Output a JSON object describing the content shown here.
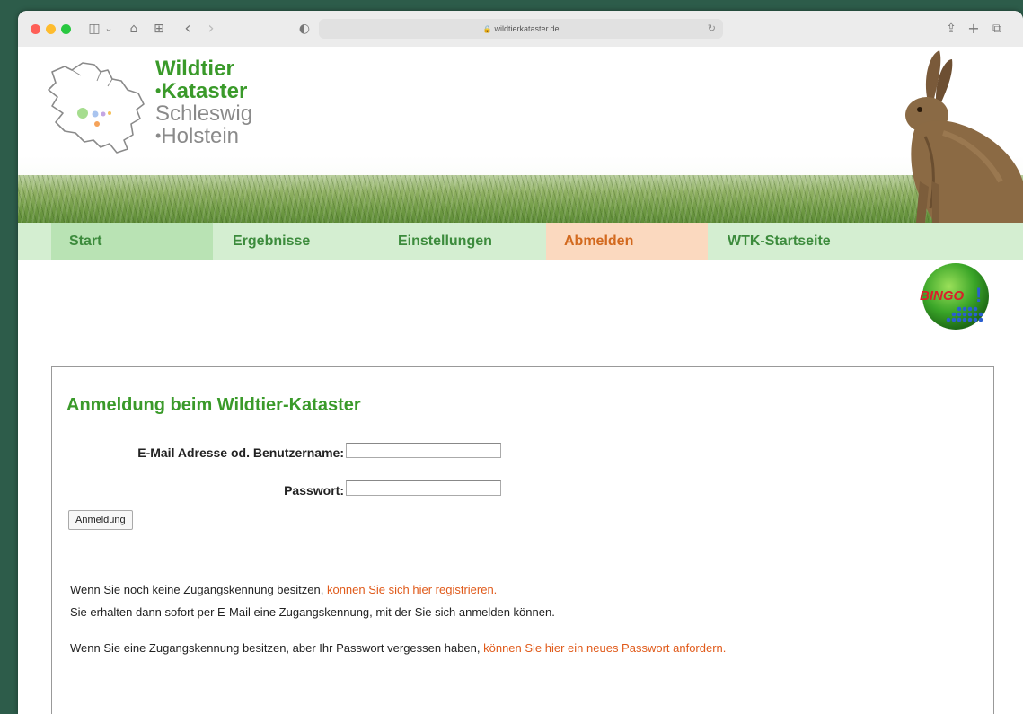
{
  "browser": {
    "url": "wildtierkataster.de",
    "lock_glyph": "🔒",
    "reload_glyph": "↻",
    "icons": [
      "sidebar-icon",
      "home-icon",
      "tab-overview-icon",
      "back-icon",
      "forward-icon",
      "privacy-icon",
      "share-icon",
      "new-tab-icon",
      "tabs-icon"
    ],
    "icon_glyphs": {
      "sidebar": "◫",
      "chevron": "⌄",
      "home": "⌂",
      "overview": "⊞",
      "back": "‹",
      "forward": "›",
      "privacy": "◐",
      "share": "⇪",
      "new_tab": "+",
      "tabs": "⧉"
    }
  },
  "logo": {
    "line1": "Wildtier",
    "line2": "Kataster",
    "line3": "Schleswig",
    "line4": "Holstein",
    "dot": "•"
  },
  "nav": {
    "items": [
      "Start",
      "Ergebnisse",
      "Einstellungen",
      "Abmelden",
      "WTK-Startseite"
    ]
  },
  "bingo": {
    "text": "BINGO",
    "exclaim": "!"
  },
  "login": {
    "title": "Anmeldung beim Wildtier-Kataster",
    "email_label": "E-Mail Adresse od. Benutzername:",
    "email_value": "",
    "password_label": "Passwort:",
    "password_value": "",
    "submit_label": "Anmeldung",
    "register_text": "Wenn Sie noch keine Zugangskennung besitzen, ",
    "register_link": "können Sie sich hier registrieren.",
    "register_info": "Sie erhalten dann sofort per E-Mail eine Zugangskennung, mit der Sie sich anmelden können.",
    "forgot_text": "Wenn Sie eine Zugangskennung besitzen, aber Ihr Passwort vergessen haben, ",
    "forgot_link": "können Sie hier ein neues Passwort anfordern."
  },
  "colors": {
    "brand_green": "#3a9a2a",
    "nav_bg": "#d4eed1",
    "nav_active": "#b9e3b4",
    "nav_logout_bg": "#fbd9bf",
    "link_orange": "#e05a1a"
  }
}
